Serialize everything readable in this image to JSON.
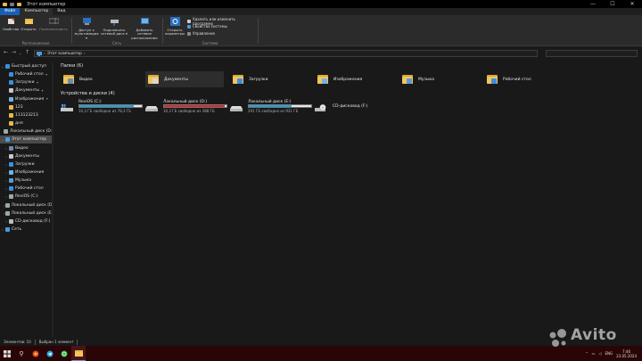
{
  "window": {
    "title": "Этот компьютер",
    "controls": [
      "—",
      "☐",
      "✕"
    ]
  },
  "ribbon_tabs": [
    {
      "label": "Файл"
    },
    {
      "label": "Компьютер"
    },
    {
      "label": "Вид"
    }
  ],
  "ribbon": {
    "location": {
      "group_label": "Расположение",
      "properties": "Свойства",
      "open": "Открыть",
      "rename": "Переименовать"
    },
    "network": {
      "group_label": "Сеть",
      "media": "Доступ к мультимедиа ▾",
      "map_drive": "Подключить сетевой диск ▾",
      "add_location": "Добавить сетевое расположение"
    },
    "system": {
      "group_label": "Система",
      "open_settings": "Открыть параметры",
      "uninstall": "Удалить или изменить программу",
      "system_props": "Свойства системы",
      "manage": "Управление"
    }
  },
  "address": {
    "path": "Этот компьютер",
    "separator": "›"
  },
  "sidebar": {
    "items": [
      {
        "label": "Быстрый доступ",
        "icon": "star-icon",
        "color": "#3b8fe0",
        "level": 0,
        "chevron": "⌄",
        "pinned": false
      },
      {
        "label": "Рабочий стол",
        "icon": "desktop-icon",
        "color": "#3b8fe0",
        "level": 1,
        "chevron": "",
        "pinned": true
      },
      {
        "label": "Загрузки",
        "icon": "download-icon",
        "color": "#3b8fe0",
        "level": 1,
        "chevron": "",
        "pinned": true
      },
      {
        "label": "Документы",
        "icon": "document-icon",
        "color": "#c8c8c8",
        "level": 1,
        "chevron": "",
        "pinned": true
      },
      {
        "label": "Изображения",
        "icon": "image-icon",
        "color": "#6fb3e8",
        "level": 1,
        "chevron": "",
        "pinned": true
      },
      {
        "label": "123",
        "icon": "folder-icon",
        "color": "#e8b84a",
        "level": 1,
        "chevron": "",
        "pinned": false
      },
      {
        "label": "113123213",
        "icon": "folder-icon",
        "color": "#e8b84a",
        "level": 1,
        "chevron": "",
        "pinned": false
      },
      {
        "label": "дня",
        "icon": "folder-icon",
        "color": "#e8b84a",
        "level": 1,
        "chevron": "",
        "pinned": false
      },
      {
        "label": "Локальный диск (D:)",
        "icon": "drive-icon",
        "color": "#9aa",
        "level": 1,
        "chevron": "",
        "pinned": false
      },
      {
        "label": "Этот компьютер",
        "icon": "computer-icon",
        "color": "#4a9ae0",
        "level": 0,
        "chevron": "⌄",
        "pinned": false,
        "selected": true
      },
      {
        "label": "Видео",
        "icon": "video-icon",
        "color": "#6a8ab0",
        "level": 1,
        "chevron": "›",
        "pinned": false
      },
      {
        "label": "Документы",
        "icon": "document-icon",
        "color": "#c8c8c8",
        "level": 1,
        "chevron": "›",
        "pinned": false
      },
      {
        "label": "Загрузки",
        "icon": "download-icon",
        "color": "#3b8fe0",
        "level": 1,
        "chevron": "›",
        "pinned": false
      },
      {
        "label": "Изображения",
        "icon": "image-icon",
        "color": "#6fb3e8",
        "level": 1,
        "chevron": "›",
        "pinned": false
      },
      {
        "label": "Музыка",
        "icon": "music-icon",
        "color": "#5a9ad8",
        "level": 1,
        "chevron": "›",
        "pinned": false
      },
      {
        "label": "Рабочий стол",
        "icon": "desktop-icon",
        "color": "#3b8fe0",
        "level": 1,
        "chevron": "›",
        "pinned": false
      },
      {
        "label": "ReviOS (C:)",
        "icon": "drive-icon",
        "color": "#9aa",
        "level": 1,
        "chevron": "›",
        "pinned": false
      },
      {
        "label": "Локальный диск (D:)",
        "icon": "drive-icon",
        "color": "#9aa",
        "level": 1,
        "chevron": "›",
        "pinned": false
      },
      {
        "label": "Локальный диск (E:)",
        "icon": "drive-icon",
        "color": "#9aa",
        "level": 1,
        "chevron": "›",
        "pinned": false
      },
      {
        "label": "CD-дисковод (F:)",
        "icon": "cd-icon",
        "color": "#bbb",
        "level": 1,
        "chevron": "›",
        "pinned": false
      },
      {
        "label": "Сеть",
        "icon": "network-icon",
        "color": "#4a9ae0",
        "level": 0,
        "chevron": "›",
        "pinned": false
      }
    ]
  },
  "folders": {
    "heading": "Папки (6)",
    "items": [
      {
        "label": "Видео",
        "icon": "video-folder-icon",
        "badge": "#6a8ab0"
      },
      {
        "label": "Документы",
        "icon": "documents-folder-icon",
        "badge": "#d8d8d8",
        "highlighted": true
      },
      {
        "label": "Загрузки",
        "icon": "downloads-folder-icon",
        "badge": "#3b8fe0"
      },
      {
        "label": "Изображения",
        "icon": "pictures-folder-icon",
        "badge": "#6fb3e8"
      },
      {
        "label": "Музыка",
        "icon": "music-folder-icon",
        "badge": "#5a9ad8"
      },
      {
        "label": "Рабочий стол",
        "icon": "desktop-folder-icon",
        "badge": "#3b8fe0"
      }
    ]
  },
  "drives": {
    "heading": "Устройства и диски (4)",
    "items": [
      {
        "label": "ReviOS (C:)",
        "free": "10,3 ГБ свободно из 78,3 ГБ",
        "used_fraction": 0.87,
        "bar_color": "#26a0da",
        "icon": "windows-drive-icon"
      },
      {
        "label": "Локальный диск (D:)",
        "free": "10,3 ГБ свободно из 388 ГБ",
        "used_fraction": 0.97,
        "bar_color": "#da2626",
        "icon": "drive-icon"
      },
      {
        "label": "Локальный диск (E:)",
        "free": "291 ГБ свободно из 931 ГБ",
        "used_fraction": 0.69,
        "bar_color": "#26a0da",
        "icon": "drive-icon"
      },
      {
        "label": "CD-дисковод (F:)",
        "free": "",
        "used_fraction": null,
        "bar_color": "",
        "icon": "cd-icon"
      }
    ]
  },
  "status": {
    "items_count": "Элементов: 10",
    "selected": "Выбран 1 элемент"
  },
  "tray": {
    "lang": "ENG",
    "time": "7:46",
    "date": "23.05.2024"
  },
  "watermark": "Avito"
}
